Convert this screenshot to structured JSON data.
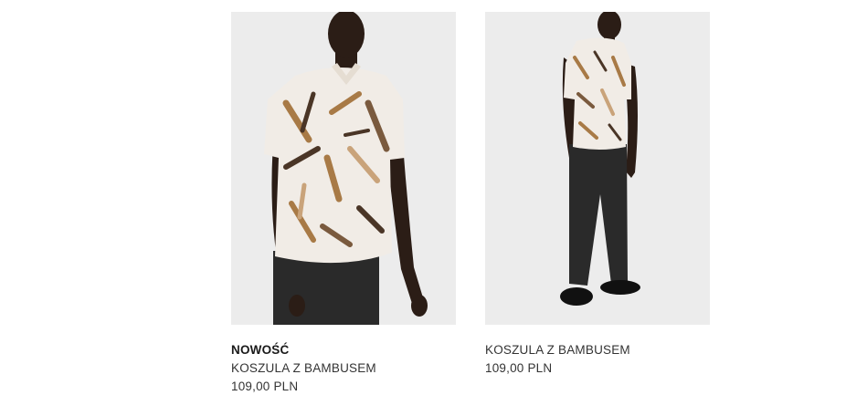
{
  "products": [
    {
      "badge": "NOWOŚĆ",
      "name": "KOSZULA Z BAMBUSEM",
      "price": "109,00 PLN"
    },
    {
      "badge": "",
      "name": "KOSZULA Z BAMBUSEM",
      "price": "109,00 PLN"
    }
  ],
  "colors": {
    "image_background": "#ececec",
    "shirt_base": "#f1ece6",
    "leaf_brown": "#a87a46",
    "leaf_dark": "#4a3526",
    "trousers": "#2a2a2a",
    "skin": "#2b1d16",
    "text": "#333333"
  }
}
